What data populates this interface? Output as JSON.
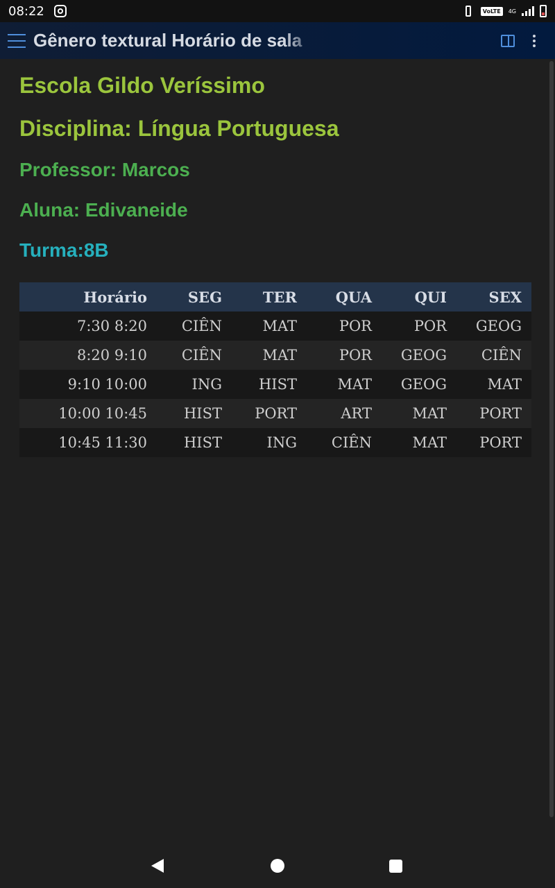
{
  "status_bar": {
    "time": "08:22",
    "volte": "VoLTE",
    "network": "4G",
    "icons": [
      "instagram-icon",
      "vibrate-icon",
      "signal-icon",
      "battery-icon"
    ]
  },
  "app_bar": {
    "title": "Gênero textural Horário de sala",
    "icons": [
      "menu-icon",
      "reader-view-icon",
      "more-options-icon"
    ]
  },
  "page": {
    "school": "Escola Gildo Veríssimo",
    "discipline": "Disciplina: Língua Portuguesa",
    "teacher": "Professor: Marcos",
    "student": "Aluna: Edivaneide",
    "class": "Turma:8B"
  },
  "schedule": {
    "headers": [
      "Horário",
      "SEG",
      "TER",
      "QUA",
      "QUI",
      "SEX"
    ],
    "rows": [
      [
        "7:30 8:20",
        "CIÊN",
        "MAT",
        "POR",
        "POR",
        "GEOG"
      ],
      [
        "8:20 9:10",
        "CIÊN",
        "MAT",
        "POR",
        "GEOG",
        "CIÊN"
      ],
      [
        "9:10 10:00",
        "ING",
        "HIST",
        "MAT",
        "GEOG",
        "MAT"
      ],
      [
        "10:00 10:45",
        "HIST",
        "PORT",
        "ART",
        "MAT",
        "PORT"
      ],
      [
        "10:45 11:30",
        "HIST",
        "ING",
        "CIÊN",
        "MAT",
        "PORT"
      ]
    ]
  },
  "nav_bar": {
    "icons": [
      "back-icon",
      "home-icon",
      "recents-icon"
    ]
  },
  "colors": {
    "title_green": "#9bc53d",
    "subtitle_green": "#4caf50",
    "class_teal": "#26b0bd",
    "header_bg": "#24344a",
    "accent_blue": "#4f8fdc"
  }
}
